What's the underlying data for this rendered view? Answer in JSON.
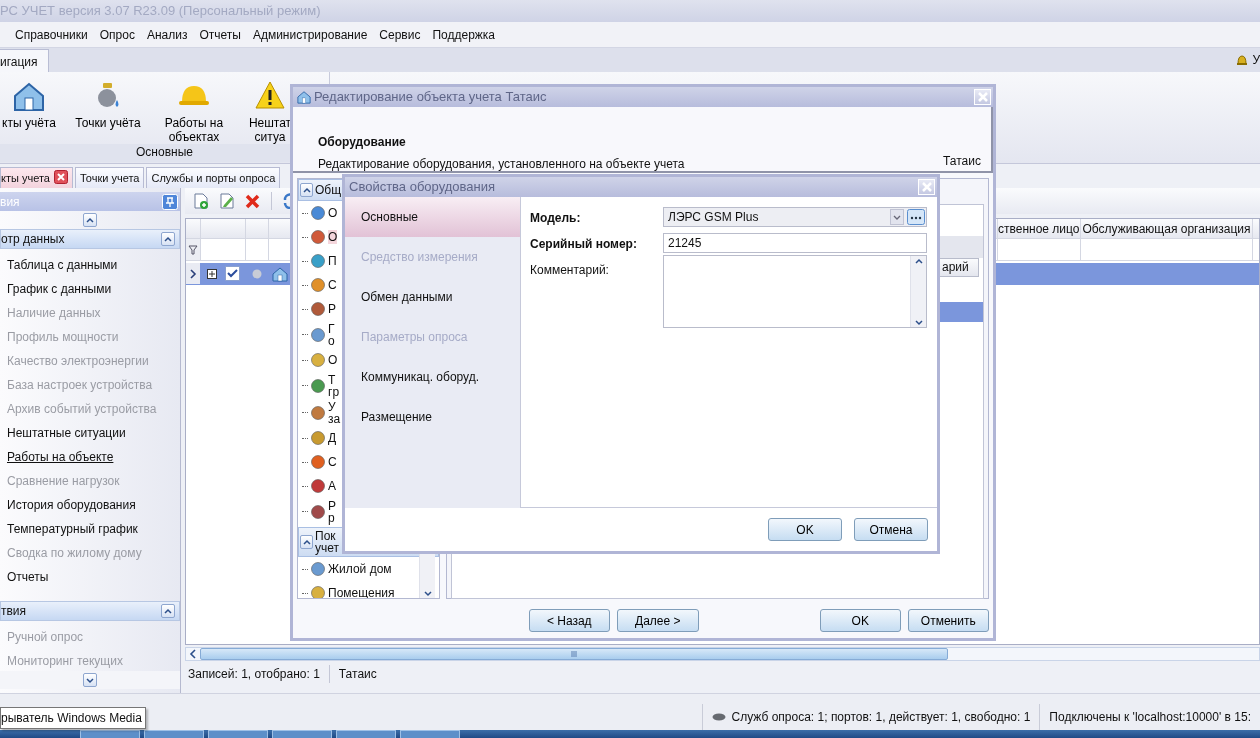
{
  "window": {
    "title": "РС УЧЕТ версия 3.07 R23.09 (Персональный режим)"
  },
  "menu": [
    "Справочники",
    "Опрос",
    "Анализ",
    "Отчеты",
    "Администрирование",
    "Сервис",
    "Поддержка"
  ],
  "user_label": "У",
  "ribbon_tabs": [
    {
      "label": "игация",
      "selected": true
    }
  ],
  "ribbon_buttons": [
    "кты учёта",
    "Точки учёта",
    "Работы на объектах",
    "Нештат ситуа"
  ],
  "ribbon_group": "Основные",
  "doc_tabs": [
    {
      "label": "кты учета",
      "selected": true,
      "closable": true
    },
    {
      "label": "Точки учета",
      "selected": false,
      "closable": false
    },
    {
      "label": "Службы и порты опроса",
      "selected": false,
      "closable": false
    }
  ],
  "nav_panel": {
    "title": "вия",
    "groups": [
      {
        "title": "отр данных",
        "expanded": true,
        "items": [
          {
            "label": "Таблица с данными",
            "disabled": false,
            "hovered": false
          },
          {
            "label": "График с данными",
            "disabled": false,
            "hovered": false
          },
          {
            "label": "Наличие данных",
            "disabled": true,
            "hovered": false
          },
          {
            "label": "Профиль мощности",
            "disabled": true,
            "hovered": false
          },
          {
            "label": "Качество электроэнергии",
            "disabled": true,
            "hovered": false
          },
          {
            "label": "База настроек устройства",
            "disabled": true,
            "hovered": false
          },
          {
            "label": "Архив событий устройства",
            "disabled": true,
            "hovered": false
          },
          {
            "label": "Нештатные ситуации",
            "disabled": false,
            "hovered": false
          },
          {
            "label": "Работы на объекте",
            "disabled": false,
            "hovered": true
          },
          {
            "label": "Сравнение нагрузок",
            "disabled": true,
            "hovered": false
          },
          {
            "label": "История оборудования",
            "disabled": false,
            "hovered": false
          },
          {
            "label": "Температурный график",
            "disabled": false,
            "hovered": false
          },
          {
            "label": "Сводка по жилому дому",
            "disabled": true,
            "hovered": false
          },
          {
            "label": "Отчеты",
            "disabled": false,
            "hovered": false
          }
        ]
      },
      {
        "title": "твия",
        "expanded": true,
        "items": [
          {
            "label": "Ручной опрос",
            "disabled": true,
            "hovered": false
          },
          {
            "label": "Мониторинг текущих",
            "disabled": true,
            "hovered": false
          }
        ]
      }
    ]
  },
  "grid": {
    "columns": [
      "ственное лицо",
      "Обслуживающая организация"
    ],
    "rows": [
      {
        "selected": true,
        "checked": true
      }
    ]
  },
  "records": [
    "Записей: 1, отобрано: 1",
    "Татаис"
  ],
  "tooltip": "рыватель Windows Media",
  "status_bar": [
    "Служб опроса: 1; портов: 1, действует: 1, свободно: 1",
    "Подключены к 'localhost:10000' в 15:"
  ],
  "edit_dialog": {
    "title": "Редактирование объекта учета Татаис",
    "header_title": "Оборудование",
    "header_text": "Редактирование оборудования, установленного на объекте учета",
    "object": "Татаис",
    "tree_groups": [
      {
        "title": "Общ",
        "items": [
          {
            "label": "О",
            "selected": false
          },
          {
            "label": "О",
            "selected": true
          },
          {
            "label": "П",
            "selected": false
          },
          {
            "label": "С",
            "selected": false
          },
          {
            "label": "Р",
            "selected": false
          },
          {
            "label": "Г\nо",
            "selected": false
          },
          {
            "label": "О",
            "selected": false
          },
          {
            "label": "Т\nгр",
            "selected": false
          },
          {
            "label": "У\nза",
            "selected": false
          },
          {
            "label": "Д",
            "selected": false
          },
          {
            "label": "С",
            "selected": false
          },
          {
            "label": "А",
            "selected": false
          },
          {
            "label": "Р\nр",
            "selected": false
          }
        ]
      },
      {
        "title": "Пок\nучет",
        "items": [
          {
            "label": "Жилой дом",
            "selected": false
          },
          {
            "label": "Помещения",
            "selected": false
          }
        ]
      }
    ],
    "grid_column": "арий",
    "buttons": [
      "< Назад",
      "Далее >",
      "OK",
      "Отменить"
    ]
  },
  "props_dialog": {
    "title": "Свойства оборудования",
    "sections": [
      {
        "label": "Основные",
        "selected": true,
        "disabled": false
      },
      {
        "label": "Средство измерения",
        "selected": false,
        "disabled": true
      },
      {
        "label": "Обмен данными",
        "selected": false,
        "disabled": false
      },
      {
        "label": "Параметры опроса",
        "selected": false,
        "disabled": true
      },
      {
        "label": "Коммуникац. оборуд.",
        "selected": false,
        "disabled": false
      },
      {
        "label": "Размещение",
        "selected": false,
        "disabled": false
      }
    ],
    "fields": [
      {
        "label": "Модель:",
        "value": "ЛЭРС GSM Plus",
        "kind": "combo"
      },
      {
        "label": "Серийный номер:",
        "value": "21245",
        "kind": "text"
      },
      {
        "label": "Комментарий:",
        "kind": "memo"
      }
    ],
    "buttons": [
      "OK",
      "Отмена"
    ]
  }
}
